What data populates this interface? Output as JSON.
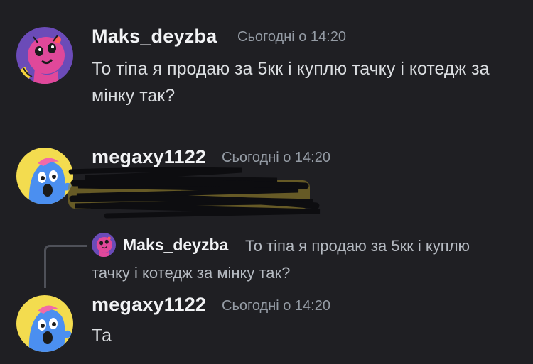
{
  "messages": [
    {
      "username": "Maks_deyzba",
      "timestamp": "Сьогодні о 14:20",
      "text": "То тіпа я продаю за 5кк і куплю тачку і котедж за мінку так?"
    },
    {
      "username": "megaxy1122",
      "timestamp": "Сьогодні о 14:20",
      "text": ""
    },
    {
      "username": "megaxy1122",
      "timestamp": "Сьогодні о 14:20",
      "text": "Та",
      "reply": {
        "username": "Maks_deyzba",
        "text": "То тіпа я продаю за 5кк і куплю тачку і котедж за мінку так?"
      }
    }
  ],
  "colors": {
    "background": "#1f1f23",
    "username": "#f2f3f5",
    "timestamp": "#949ba4",
    "text": "#dbdee1",
    "avatar_maks_bg": "#6b4bb8",
    "avatar_megaxy_bg": "#f3dc4f"
  },
  "icons": {
    "avatar_maks": "pink-creature-avatar-icon",
    "avatar_megaxy": "blue-creature-avatar-icon"
  }
}
